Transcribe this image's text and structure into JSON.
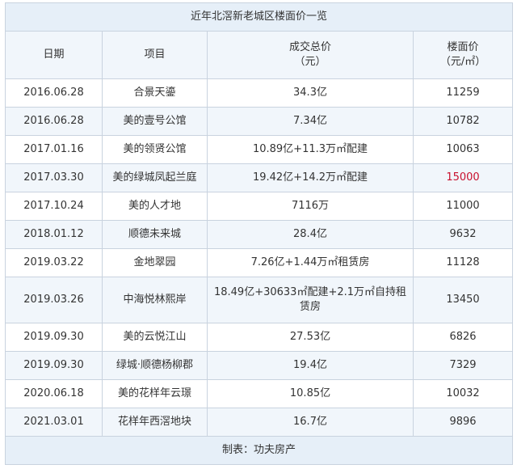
{
  "title": "近年北滘新老城区楼面价一览",
  "headers": {
    "date": "日期",
    "project": "项目",
    "total_price": "成交总价",
    "total_price_unit": "（元）",
    "floor_price": "楼面价",
    "floor_price_unit": "（元/㎡）"
  },
  "rows": [
    {
      "date": "2016.06.28",
      "project": "合景天鎏",
      "total": "34.3亿",
      "floor": "11259"
    },
    {
      "date": "2016.06.28",
      "project": "美的壹号公馆",
      "total": "7.34亿",
      "floor": "10782"
    },
    {
      "date": "2017.01.16",
      "project": "美的领贤公馆",
      "total": "10.89亿+11.3万㎡配建",
      "floor": "10063"
    },
    {
      "date": "2017.03.30",
      "project": "美的绿城凤起兰庭",
      "total": "19.42亿+14.2万㎡配建",
      "floor": "15000"
    },
    {
      "date": "2017.10.24",
      "project": "美的人才地",
      "total": "7116万",
      "floor": "11000"
    },
    {
      "date": "2018.01.12",
      "project": "顺德未来城",
      "total": "28.4亿",
      "floor": "9632"
    },
    {
      "date": "2019.03.22",
      "project": "金地翠园",
      "total": "7.26亿+1.44万㎡租赁房",
      "floor": "11128"
    },
    {
      "date": "2019.03.26",
      "project": "中海悦林熙岸",
      "total": "18.49亿+30633㎡配建+2.1万㎡自持租赁房",
      "floor": "13450"
    },
    {
      "date": "2019.09.30",
      "project": "美的云悦江山",
      "total": "27.53亿",
      "floor": "6826"
    },
    {
      "date": "2019.09.30",
      "project": "绿城·顺德杨柳郡",
      "total": "19.4亿",
      "floor": "7329"
    },
    {
      "date": "2020.06.18",
      "project": "美的花样年云璟",
      "total": "10.85亿",
      "floor": "10032"
    },
    {
      "date": "2021.03.01",
      "project": "花样年西滘地块",
      "total": "16.7亿",
      "floor": "9896"
    }
  ],
  "highlight_color": "#c8102e",
  "footer": "制表：功夫房产"
}
